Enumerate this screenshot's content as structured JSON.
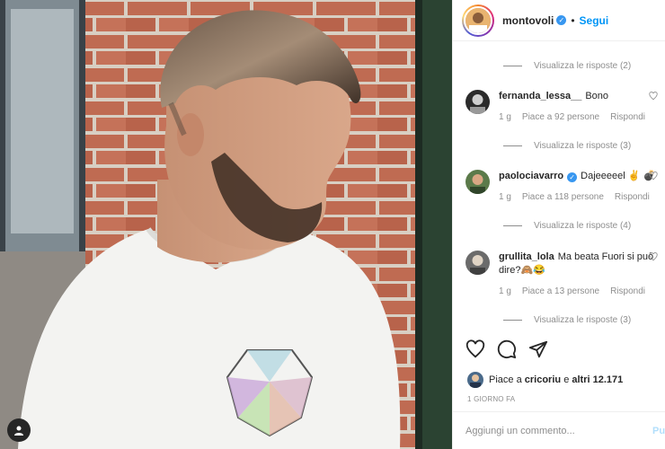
{
  "post_author": {
    "username": "montovoli",
    "verified": true,
    "follow_label": "Segui"
  },
  "comments": [
    {
      "username": "fernanda_lessa__",
      "verified": false,
      "text": "Bono",
      "time": "1 g",
      "likes": "Piace a 92 persone",
      "reply_label": "Rispondi",
      "view_replies": "Visualizza le risposte (3)",
      "avatar_color": "#3a3a3a"
    },
    {
      "username": "paolociavarro",
      "verified": true,
      "text": "Dajeeeeel ✌️ 💣",
      "time": "1 g",
      "likes": "Piace a 118 persone",
      "reply_label": "Rispondi",
      "view_replies": "Visualizza le risposte (4)",
      "avatar_color": "#5b7a4a"
    },
    {
      "username": "grullita_lola",
      "verified": false,
      "text": "Ma beata Fuori si può dire?🙈😂",
      "time": "1 g",
      "likes": "Piace a 13 persone",
      "reply_label": "Rispondi",
      "view_replies": "Visualizza le risposte (3)",
      "avatar_color": "#6b6b6b"
    }
  ],
  "top_view_replies": "Visualizza le risposte (2)",
  "likes_summary": {
    "prefix": "Piace a ",
    "user": "cricoriu",
    "middle": " e ",
    "others": "altri 12.171"
  },
  "post_date": "1 GIORNO FA",
  "add_comment": {
    "placeholder": "Aggiungi un commento...",
    "post_label": "Pubblica"
  },
  "icons": {
    "like": "heart-icon",
    "comment": "comment-icon",
    "share": "share-icon",
    "user_tag": "user-tag-icon"
  }
}
